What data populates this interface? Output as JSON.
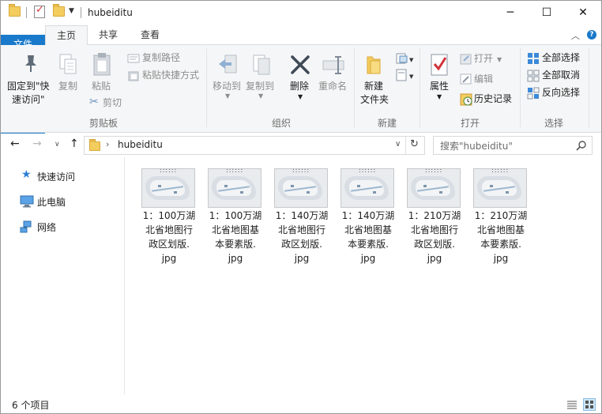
{
  "window": {
    "title": "hubeiditu",
    "controls": {
      "minimize": "─",
      "maximize": "☐",
      "close": "✕"
    }
  },
  "tabs": [
    {
      "label": "文件"
    },
    {
      "label": "主页"
    },
    {
      "label": "共享"
    },
    {
      "label": "查看"
    }
  ],
  "ribbon": {
    "clipboard": {
      "pin_label_1": "固定到\"快",
      "pin_label_2": "速访问\"",
      "copy": "复制",
      "paste": "粘贴",
      "copy_path": "复制路径",
      "paste_shortcut": "粘贴快捷方式",
      "cut": "剪切",
      "group": "剪贴板"
    },
    "organize": {
      "move_to": "移动到",
      "copy_to": "复制到",
      "delete": "删除",
      "rename": "重命名",
      "group": "组织"
    },
    "new": {
      "new_folder_1": "新建",
      "new_folder_2": "文件夹",
      "group": "新建"
    },
    "open": {
      "properties": "属性",
      "open": "打开",
      "edit": "编辑",
      "history": "历史记录",
      "group": "打开"
    },
    "select": {
      "select_all": "全部选择",
      "select_none": "全部取消",
      "invert": "反向选择",
      "group": "选择"
    }
  },
  "address": {
    "path": "hubeiditu",
    "search_placeholder": "搜索\"hubeiditu\""
  },
  "nav_pane": [
    {
      "label": "快速访问"
    },
    {
      "label": "此电脑"
    },
    {
      "label": "网络"
    }
  ],
  "files": [
    {
      "line1": "1：100万湖",
      "line2": "北省地图行",
      "line3": "政区划版.",
      "line4": "jpg"
    },
    {
      "line1": "1：100万湖",
      "line2": "北省地图基",
      "line3": "本要素版.",
      "line4": "jpg"
    },
    {
      "line1": "1：140万湖",
      "line2": "北省地图行",
      "line3": "政区划版.",
      "line4": "jpg"
    },
    {
      "line1": "1：140万湖",
      "line2": "北省地图基",
      "line3": "本要素版.",
      "line4": "jpg"
    },
    {
      "line1": "1：210万湖",
      "line2": "北省地图行",
      "line3": "政区划版.",
      "line4": "jpg"
    },
    {
      "line1": "1：210万湖",
      "line2": "北省地图基",
      "line3": "本要素版.",
      "line4": "jpg"
    }
  ],
  "status": {
    "count": "6 个项目"
  },
  "colors": {
    "accent": "#1979ca",
    "folder": "#f4cd5f",
    "ribbon_bg": "#f5f6f7"
  }
}
